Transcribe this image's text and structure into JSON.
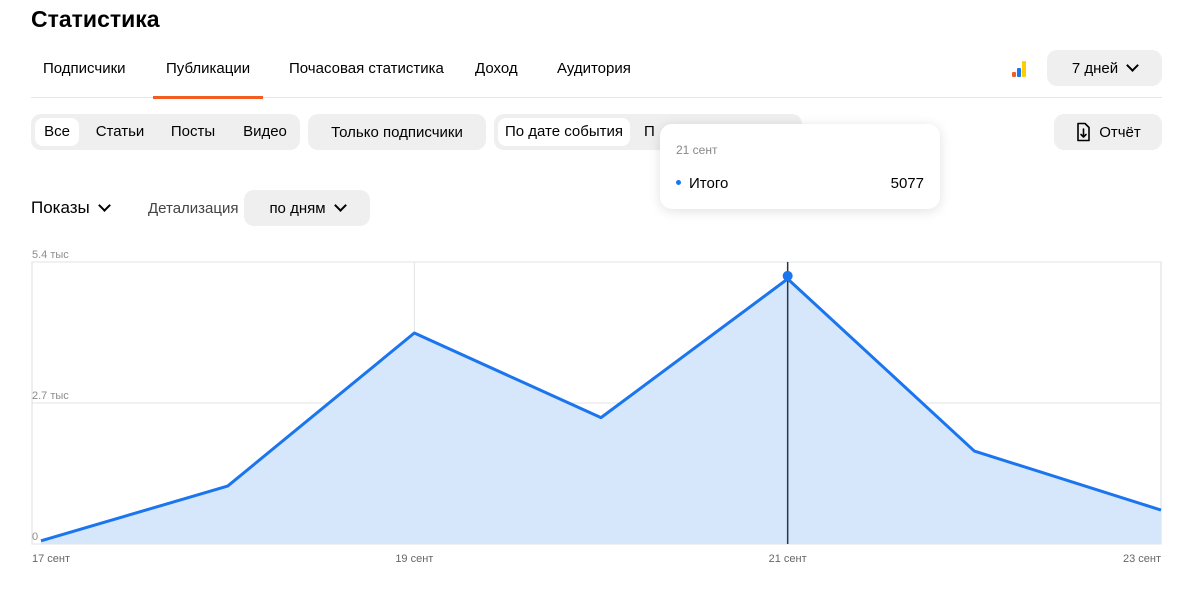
{
  "page": {
    "title": "Статистика"
  },
  "tabs": [
    {
      "label": "Подписчики"
    },
    {
      "label": "Публикации"
    },
    {
      "label": "Почасовая статистика"
    },
    {
      "label": "Доход"
    },
    {
      "label": "Аудитория"
    }
  ],
  "period": {
    "label": "7 дней"
  },
  "filters": {
    "content_types": [
      "Все",
      "Статьи",
      "Посты",
      "Видео"
    ],
    "subscribers_only": "Только подписчики",
    "date_mode": {
      "active": "По дате события",
      "other": "П"
    }
  },
  "report_button": {
    "label": "Отчёт"
  },
  "metric": {
    "label": "Показы"
  },
  "detail": {
    "label": "Детализация",
    "value": "по дням"
  },
  "tooltip": {
    "date": "21 сент",
    "series": "Итого",
    "value": "5077"
  },
  "colors": {
    "accent": "#f35d21",
    "line": "#1a75ee",
    "area": "#d6e7fb"
  },
  "chart_data": {
    "type": "area",
    "x": [
      "17 сент",
      "18 сент",
      "19 сент",
      "20 сент",
      "21 сент",
      "22 сент",
      "23 сент"
    ],
    "x_tick_labels": [
      "17 сент",
      "19 сент",
      "21 сент",
      "23 сент"
    ],
    "series": [
      {
        "name": "Итого",
        "values": [
          60,
          1110,
          4040,
          2420,
          5077,
          1780,
          650
        ]
      }
    ],
    "y_tick_labels": [
      "0",
      "2.7 тыс",
      "5.4 тыс"
    ],
    "y_ticks": [
      0,
      2700,
      5400
    ],
    "ylim": [
      0,
      5400
    ],
    "highlight_x": "21 сент",
    "grid": true
  }
}
